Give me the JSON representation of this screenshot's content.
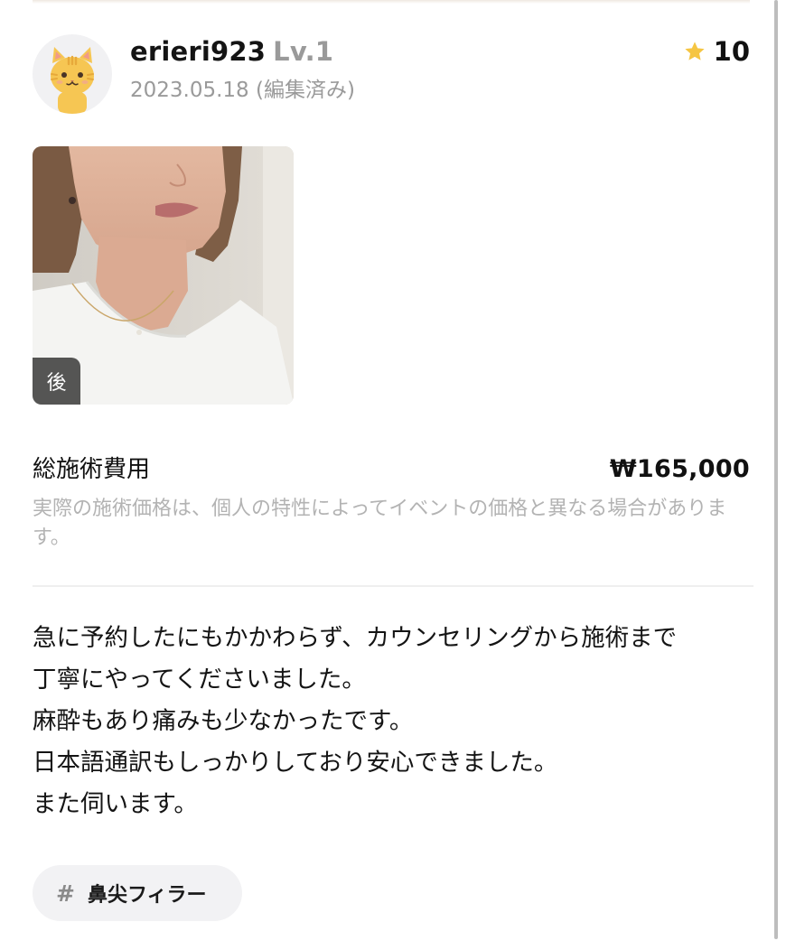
{
  "review": {
    "user": {
      "name": "erieri923",
      "level": "Lv.1",
      "date": "2023.05.18 (編集済み)",
      "avatar_icon": "cat-avatar-icon"
    },
    "rating": {
      "icon": "star-icon",
      "value": "10",
      "color": "#f5c542"
    },
    "photo": {
      "badge": "後"
    },
    "cost": {
      "label": "総施術費用",
      "value": "₩165,000",
      "note": "実際の施術価格は、個人の特性によってイベントの価格と異なる場合があります。"
    },
    "body_lines": [
      "急に予約したにもかかわらず、カウンセリングから施術まで",
      "丁寧にやってくださいました。",
      "麻酔もあり痛みも少なかったです。",
      "日本語通訳もしっかりしており安心できました。",
      "また伺います。"
    ],
    "tag": {
      "hash": "#",
      "label": "鼻尖フィラー"
    }
  }
}
